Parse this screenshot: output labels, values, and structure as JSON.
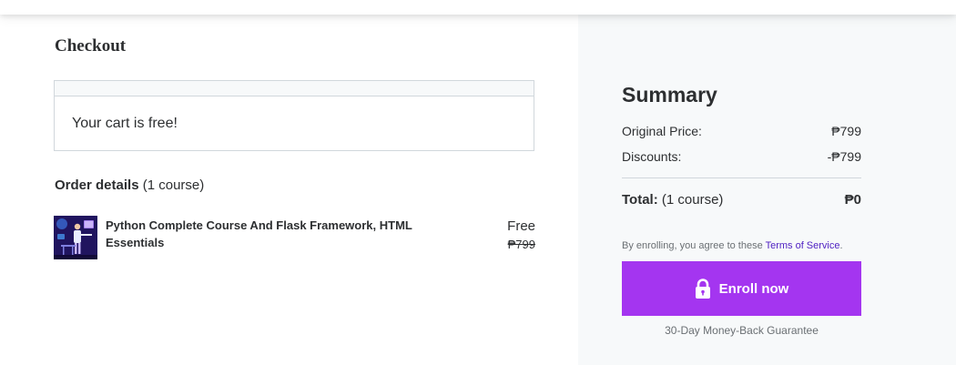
{
  "checkout": {
    "title": "Checkout",
    "cart_message": "Your cart is free!"
  },
  "order": {
    "heading": "Order details",
    "count": "(1 course)",
    "course": {
      "title": "Python Complete Course And Flask Framework, HTML Essentials",
      "price": "Free",
      "original_price": "₱799",
      "thumbnail_icon": "course-thumbnail-illustration"
    }
  },
  "summary": {
    "title": "Summary",
    "original_price_label": "Original Price:",
    "original_price_value": "₱799",
    "discounts_label": "Discounts:",
    "discounts_value": "-₱799",
    "total_label": "Total:",
    "total_count": "(1 course)",
    "total_value": "₱0",
    "terms_prefix": "By enrolling, you agree to these ",
    "terms_link": "Terms of Service",
    "terms_suffix": ".",
    "enroll_label": "Enroll now",
    "enroll_icon": "lock-icon",
    "guarantee": "30-Day Money-Back Guarantee"
  },
  "colors": {
    "accent": "#a435f0",
    "link": "#5022c3",
    "text": "#2d2f31",
    "panel_bg": "#f7f9fa",
    "border": "#d1d7dc"
  }
}
